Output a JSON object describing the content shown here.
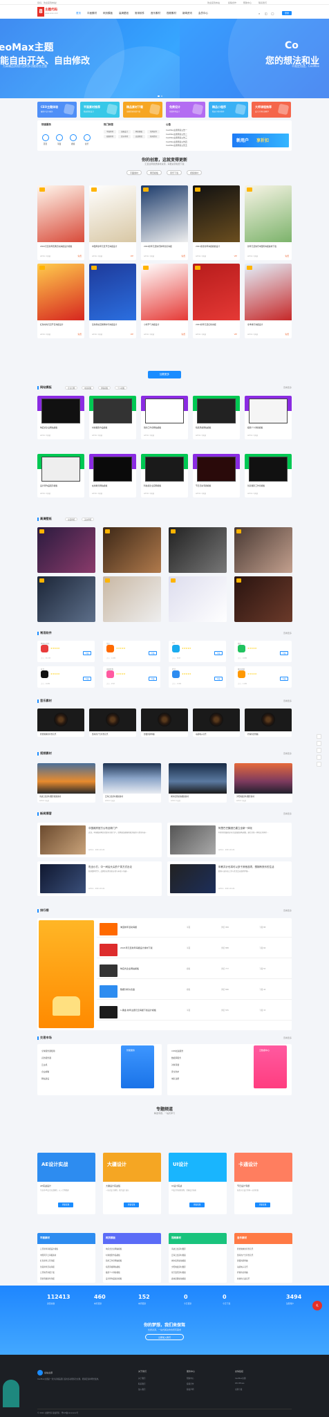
{
  "topbar": {
    "left": "您好，欢迎来到本站！",
    "right": [
      "欢迎来到本站",
      "投稿合作",
      "帮助中心",
      "联系我们"
    ]
  },
  "header": {
    "logo_mark": "8",
    "logo_name": "主题代码",
    "logo_sub": "www.xxxx.com",
    "nav": [
      "首页",
      "平面素材",
      "网页模板",
      "高清壁纸",
      "常用软件",
      "音乐素材",
      "视频素材",
      "新闻资讯",
      "会员中心"
    ],
    "login": "登录"
  },
  "banner": {
    "left_title": "eoMax主题",
    "left_slogan": "能自由开关、自由修改",
    "left_sub": "为高端品质而打造的多功能综合主题",
    "left_btn": "了解更多",
    "right_title": "Co",
    "right_slogan": "您的想法和业",
    "right_sub": "不限定用途，CeoMax"
  },
  "categories": [
    {
      "title": "CEO主题体验",
      "sub": "最新产品与服务",
      "color": "#4f8ff7"
    },
    {
      "title": "平面素材推荐",
      "sub": "精选优质设计",
      "color": "#38c8e8"
    },
    {
      "title": "精品素材下载",
      "sub": "海量资源免费下载",
      "color": "#f6a623"
    },
    {
      "title": "免费设计",
      "sub": "免费素材设计",
      "color": "#b36cf2"
    },
    {
      "title": "精品小程序",
      "sub": "精选小程序推荐",
      "color": "#3ab1f5"
    },
    {
      "title": "大师课程推荐",
      "sub": "设计大师在线教学",
      "color": "#f5664b"
    }
  ],
  "services": {
    "title": "快速服务",
    "items": [
      "首页",
      "平面",
      "视频",
      "音乐"
    ],
    "hot_title": "热门标签",
    "hot_tags": [
      "平面素材",
      "海报设计",
      "网页模板",
      "常用软件",
      "视频素材",
      "音乐素材",
      "高清壁纸",
      "新闻资讯"
    ],
    "notice_title": "公告",
    "notices": [
      "CeoMax主题测试公告一",
      "CeoMax主题测试公告二",
      "CeoMax主题测试公告三",
      "CeoMax主题测试公告四",
      "CeoMax主题测试公告五"
    ],
    "promo": "新用户",
    "promo_b": "享折扣"
  },
  "featured": {
    "title": "你的创意，这就变得更新",
    "sub": "汇集全网优质素材资源，海量资源免费下载",
    "tabs": [
      "平面素材",
      "网页模板",
      "音乐下载",
      "视频素材"
    ],
    "cards": [
      {
        "title": "2022元旦新年庆典活动海报设计模板",
        "meta": "admin 1天前",
        "price": "免费"
      },
      {
        "title": "中国风新年元旦节日海报设计",
        "meta": "admin 1天前",
        "price": "VIP"
      },
      {
        "title": "2024新年元旦快乐跨年创意海报",
        "meta": "admin 1天前",
        "price": "免费"
      },
      {
        "title": "2021黑金新年海报模板设计",
        "meta": "admin 1天前",
        "price": "VIP"
      },
      {
        "title": "新年元旦快乐中国风海报素材下载",
        "meta": "admin 1天前",
        "price": "免费"
      },
      {
        "title": "红色时尚元旦节日海报设计",
        "meta": "admin 1天前",
        "price": "免费"
      },
      {
        "title": "蓝色科技互联网时代海报设计",
        "meta": "admin 1天前",
        "price": "VIP"
      },
      {
        "title": "小寒节气海报设计",
        "meta": "admin 1天前",
        "price": "免费"
      },
      {
        "title": "2021新年元旦红色海报",
        "meta": "admin 1天前",
        "price": "VIP"
      },
      {
        "title": "冬季旅行海报设计",
        "meta": "admin 1天前",
        "price": "免费"
      }
    ],
    "load_more": "加载更多"
  },
  "web_templates": {
    "title": "网站模板",
    "pills": [
      "企业官网",
      "电商模板",
      "博客模板",
      "个人模板"
    ],
    "more": "查看更多",
    "cards": [
      {
        "title": "响应式企业网站模板",
        "meta": "admin 1天前"
      },
      {
        "title": "时尚摄影作品模板",
        "meta": "admin 1天前"
      },
      {
        "title": "简约工作室网站模板",
        "meta": "admin 1天前"
      },
      {
        "title": "暗黑风格网站模板",
        "meta": "admin 1天前"
      },
      {
        "title": "极简个人博客模板",
        "meta": "admin 1天前"
      },
      {
        "title": "设计师作品展示模板",
        "meta": "admin 1天前"
      },
      {
        "title": "在线教育网站模板",
        "meta": "admin 1天前"
      },
      {
        "title": "科技感企业官网模板",
        "meta": "admin 1天前"
      },
      {
        "title": "节日活动专题模板",
        "meta": "admin 1天前"
      },
      {
        "title": "创意摄影工作室模板",
        "meta": "admin 1天前"
      }
    ]
  },
  "wallpapers": {
    "title": "高清壁纸",
    "pills": [
      "动漫壁纸",
      "美女壁纸"
    ],
    "more": "查看更多"
  },
  "software": {
    "title": "常用软件",
    "more": "查看更多",
    "apps": [
      {
        "name": "网易云音乐",
        "size": "大小：65.3M",
        "dl": "下载",
        "color": "#e83b3b"
      },
      {
        "name": "淘宝",
        "size": "大小：120M",
        "dl": "下载",
        "color": "#ff6a00"
      },
      {
        "name": "QQ",
        "size": "大小：88M",
        "dl": "下载",
        "color": "#1aabee"
      },
      {
        "name": "微信",
        "size": "大小：180M",
        "dl": "下载",
        "color": "#21c25f"
      },
      {
        "name": "抖音",
        "size": "大小：200M",
        "dl": "下载",
        "color": "#111111"
      },
      {
        "name": "美图秀秀",
        "size": "大小：95M",
        "dl": "下载",
        "color": "#ff5aa0"
      },
      {
        "name": "钉钉",
        "size": "大小：150M",
        "dl": "下载",
        "color": "#2d8cf0"
      },
      {
        "name": "腾讯视频",
        "size": "大小：110M",
        "dl": "下载",
        "color": "#ff9800"
      }
    ]
  },
  "music": {
    "title": "音乐素材",
    "more": "查看更多",
    "cards": [
      "轻松愉快的背景音乐",
      "激昂的广告背景音乐",
      "舒缓的钢琴曲",
      "动感电子音乐",
      "抒情的吉他曲"
    ]
  },
  "video": {
    "title": "视频素材",
    "more": "查看更多",
    "cards": [
      {
        "title": "海边日出延时摄影视频素材",
        "meta": "admin 1天前"
      },
      {
        "title": "云海日出延时视频素材",
        "meta": "admin 1天前"
      },
      {
        "title": "城市夜景航拍视频素材",
        "meta": "admin 1天前"
      },
      {
        "title": "夕阳晚霞延时摄影素材",
        "meta": "admin 1天前"
      }
    ]
  },
  "news": {
    "title": "新闻博客",
    "more": "查看更多",
    "items": [
      {
        "title": "中国政府官方公布全新门户",
        "desc": "近日，中国政府网正式发布全新门户，提供更加便捷的政务服务与资讯内容...",
        "meta": "admin · 2021-01-01"
      },
      {
        "title": "阿里巴巴集团已建立全新一体化",
        "desc": "阿里巴巴集团宣布完成组织架构调整，建立全新一体化业务体系...",
        "meta": "admin · 2021-01-01"
      },
      {
        "title": "吃出小打，中一间后头尖的个茶方式出论",
        "desc": "新消费时代下，品牌正在用全新方式与年轻人沟通...",
        "meta": "admin · 2021-01-01"
      },
      {
        "title": "年薪共计也将可以多于其他选项，想拥有快乐的生活",
        "desc": "职场人如何在工作与生活之间找到平衡...",
        "meta": "admin · 2021-01-01"
      }
    ]
  },
  "ranking": {
    "title": "排行榜",
    "more": "查看更多",
    "rows": [
      {
        "title": "淘宝新年活动海报",
        "tag": "平面",
        "c1": "浏览 999",
        "c2": "下载 88",
        "color": "#ff6a00"
      },
      {
        "title": "2021年元旦新年海报设计素材下载",
        "tag": "平面",
        "c1": "浏览 888",
        "c2": "下载 66",
        "color": "#dd2c2c"
      },
      {
        "title": "响应式企业网站模板",
        "tag": "模板",
        "c1": "浏览 777",
        "c2": "下载 55",
        "color": "#333333"
      },
      {
        "title": "数据分析仪表盘",
        "tag": "模板",
        "c1": "浏览 666",
        "c2": "下载 44",
        "color": "#2d8cf0"
      },
      {
        "title": "1.黑金·新年主题元旦海报下载设计模板",
        "tag": "平面",
        "c1": "浏览 555",
        "c2": "下载 33",
        "color": "#1c1c1c"
      }
    ]
  },
  "trading": {
    "title": "交易市场",
    "more": "查看更多",
    "left_label": "智能服务",
    "right_label": "云数据中心",
    "left_lines": [
      "全球服务器租用",
      "高防服务器",
      "云主机",
      "企业邮箱",
      "网站建设"
    ],
    "right_lines": [
      "CDN加速服务",
      "数据库服务",
      "对象存储",
      "安全防护",
      "域名注册"
    ]
  },
  "topics": {
    "title": "专题频道",
    "sub": "精选专题，一站式学习",
    "cards": [
      {
        "big": "AE设计实战",
        "title": "AE实战设计",
        "desc": "专业的AE设计实战课程，从入门到精通",
        "btn": "查看专题",
        "color": "#2d8cf0"
      },
      {
        "big": "大疆设计",
        "title": "大疆设计实战班",
        "desc": "一站式设计课程，助力设计成长",
        "btn": "查看专题",
        "color": "#f5a623"
      },
      {
        "big": "UI设计",
        "title": "UI设计实战",
        "desc": "UI设计师进阶课程，掌握设计技能",
        "btn": "查看专题",
        "color": "#19b5fe"
      },
      {
        "big": "卡通设计",
        "title": "节日设计专题",
        "desc": "各类节日设计素材一站式获取",
        "btn": "查看专题",
        "color": "#ff7e5f"
      }
    ]
  },
  "lists": [
    {
      "title": "平面素材",
      "color": "#2d8cf0",
      "items": [
        "元旦新年海报设计模板",
        "中国风节日海报素材",
        "红色新年元旦海报",
        "创意跨年活动海报",
        "元旦快乐海报下载",
        "黑金风格新年海报",
        "2021新年主题海报",
        "喜庆元旦节日模板",
        "时尚促销海报设计",
        "简约新年贺卡设计"
      ]
    },
    {
      "title": "网页模板",
      "color": "#5b6cf7",
      "items": [
        "响应式企业网站模板",
        "时尚摄影作品模板",
        "简约工作室网站模板",
        "暗黑风格网站模板",
        "极简个人博客模板",
        "设计师作品展示模板",
        "在线教育网站模板",
        "科技感企业官网模板",
        "节日活动专题模板",
        "创意摄影工作室模板"
      ]
    },
    {
      "title": "视频素材",
      "color": "#19c37d",
      "items": [
        "海边日出延时摄影",
        "云海日出延时视频",
        "城市夜景航拍视频",
        "夕阳晚霞延时摄影",
        "星空银河延时视频",
        "森林晨雾航拍视频",
        "雪山风光延时视频",
        "沙漠日落航拍素材",
        "湖面倒影延时视频",
        "草原风光航拍素材"
      ]
    },
    {
      "title": "音乐素材",
      "color": "#ff7a45",
      "items": [
        "轻松愉快的背景音乐",
        "激昂的广告背景音乐",
        "舒缓的钢琴曲",
        "动感电子音乐",
        "抒情的吉他曲",
        "欢快的儿童音乐",
        "大气的史诗音乐",
        "温馨的婚礼音乐",
        "神秘的悬疑音乐",
        "浪漫的小提琴曲"
      ]
    }
  ],
  "stats": {
    "items": [
      {
        "num": "112413",
        "label": "资源总数"
      },
      {
        "num": "460",
        "label": "本月更新"
      },
      {
        "num": "152",
        "label": "本周更新"
      },
      {
        "num": "0",
        "label": "今日更新"
      },
      {
        "num": "0",
        "label": "今日下载"
      },
      {
        "num": "3494",
        "label": "注册用户"
      }
    ],
    "cta": "你的梦想，我们来保驾",
    "cta_sub": "优质资源，一站式解决你的所有需求",
    "cta_btn": "立即加入我们"
  },
  "footer": {
    "logo": "总站主题",
    "about": "CeoMax主题是一款为高端品质打造的多功能综合主题，能满足多种场景使用。",
    "cols": [
      {
        "title": "关于我们",
        "items": [
          "关于我们",
          "联系我们",
          "加入我们"
        ]
      },
      {
        "title": "服务中心",
        "items": [
          "帮助中心",
          "投稿合作",
          "版权声明"
        ]
      },
      {
        "title": "友情链接",
        "items": [
          "CeoMax主题",
          "WordPress",
          "主题下载"
        ]
      }
    ],
    "copyright": "© 2021 主题代码 版权所有 · 粤ICP备xxxxxxxx号"
  }
}
